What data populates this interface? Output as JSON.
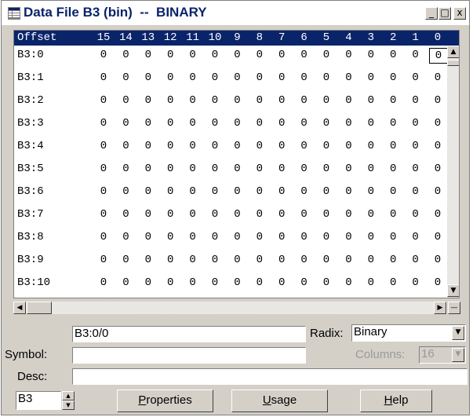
{
  "window": {
    "title": "Data File B3 (bin)  --  BINARY",
    "minimize": "_",
    "maximize": "□",
    "close": "x"
  },
  "grid": {
    "offset_header": "Offset",
    "bit_headers": [
      "15",
      "14",
      "13",
      "12",
      "11",
      "10",
      "9",
      "8",
      "7",
      "6",
      "5",
      "4",
      "3",
      "2",
      "1",
      "0"
    ],
    "rows": [
      {
        "label": "B3:0",
        "bits": [
          "0",
          "0",
          "0",
          "0",
          "0",
          "0",
          "0",
          "0",
          "0",
          "0",
          "0",
          "0",
          "0",
          "0",
          "0",
          "0"
        ]
      },
      {
        "label": "B3:1",
        "bits": [
          "0",
          "0",
          "0",
          "0",
          "0",
          "0",
          "0",
          "0",
          "0",
          "0",
          "0",
          "0",
          "0",
          "0",
          "0",
          "0"
        ]
      },
      {
        "label": "B3:2",
        "bits": [
          "0",
          "0",
          "0",
          "0",
          "0",
          "0",
          "0",
          "0",
          "0",
          "0",
          "0",
          "0",
          "0",
          "0",
          "0",
          "0"
        ]
      },
      {
        "label": "B3:3",
        "bits": [
          "0",
          "0",
          "0",
          "0",
          "0",
          "0",
          "0",
          "0",
          "0",
          "0",
          "0",
          "0",
          "0",
          "0",
          "0",
          "0"
        ]
      },
      {
        "label": "B3:4",
        "bits": [
          "0",
          "0",
          "0",
          "0",
          "0",
          "0",
          "0",
          "0",
          "0",
          "0",
          "0",
          "0",
          "0",
          "0",
          "0",
          "0"
        ]
      },
      {
        "label": "B3:5",
        "bits": [
          "0",
          "0",
          "0",
          "0",
          "0",
          "0",
          "0",
          "0",
          "0",
          "0",
          "0",
          "0",
          "0",
          "0",
          "0",
          "0"
        ]
      },
      {
        "label": "B3:6",
        "bits": [
          "0",
          "0",
          "0",
          "0",
          "0",
          "0",
          "0",
          "0",
          "0",
          "0",
          "0",
          "0",
          "0",
          "0",
          "0",
          "0"
        ]
      },
      {
        "label": "B3:7",
        "bits": [
          "0",
          "0",
          "0",
          "0",
          "0",
          "0",
          "0",
          "0",
          "0",
          "0",
          "0",
          "0",
          "0",
          "0",
          "0",
          "0"
        ]
      },
      {
        "label": "B3:8",
        "bits": [
          "0",
          "0",
          "0",
          "0",
          "0",
          "0",
          "0",
          "0",
          "0",
          "0",
          "0",
          "0",
          "0",
          "0",
          "0",
          "0"
        ]
      },
      {
        "label": "B3:9",
        "bits": [
          "0",
          "0",
          "0",
          "0",
          "0",
          "0",
          "0",
          "0",
          "0",
          "0",
          "0",
          "0",
          "0",
          "0",
          "0",
          "0"
        ]
      },
      {
        "label": "B3:10",
        "bits": [
          "0",
          "0",
          "0",
          "0",
          "0",
          "0",
          "0",
          "0",
          "0",
          "0",
          "0",
          "0",
          "0",
          "0",
          "0",
          "0"
        ]
      }
    ],
    "selected_row": 0,
    "selected_col": 15
  },
  "address_field": {
    "value": "B3:0/0"
  },
  "radix": {
    "label": "Radix:",
    "value": "Binary"
  },
  "symbol": {
    "label": "Symbol:",
    "value": ""
  },
  "columns": {
    "label": "Columns:",
    "value": "16"
  },
  "desc": {
    "label": "Desc:",
    "value": ""
  },
  "file_field": {
    "value": "B3"
  },
  "buttons": {
    "properties": {
      "mnemonic": "P",
      "rest": "roperties"
    },
    "usage": {
      "mnemonic": "U",
      "rest": "sage"
    },
    "help": {
      "mnemonic": "H",
      "rest": "elp"
    }
  },
  "icons": {
    "window_icon": "data-table-icon",
    "scroll_up": "▲",
    "scroll_down": "▼",
    "scroll_left": "◀",
    "scroll_right": "▶",
    "dropdown": "▼",
    "spin_up": "▲",
    "spin_down": "▼"
  },
  "colors": {
    "header_bg": "#0a246a",
    "title_text": "#0a246a",
    "face": "#d4d0c8"
  }
}
